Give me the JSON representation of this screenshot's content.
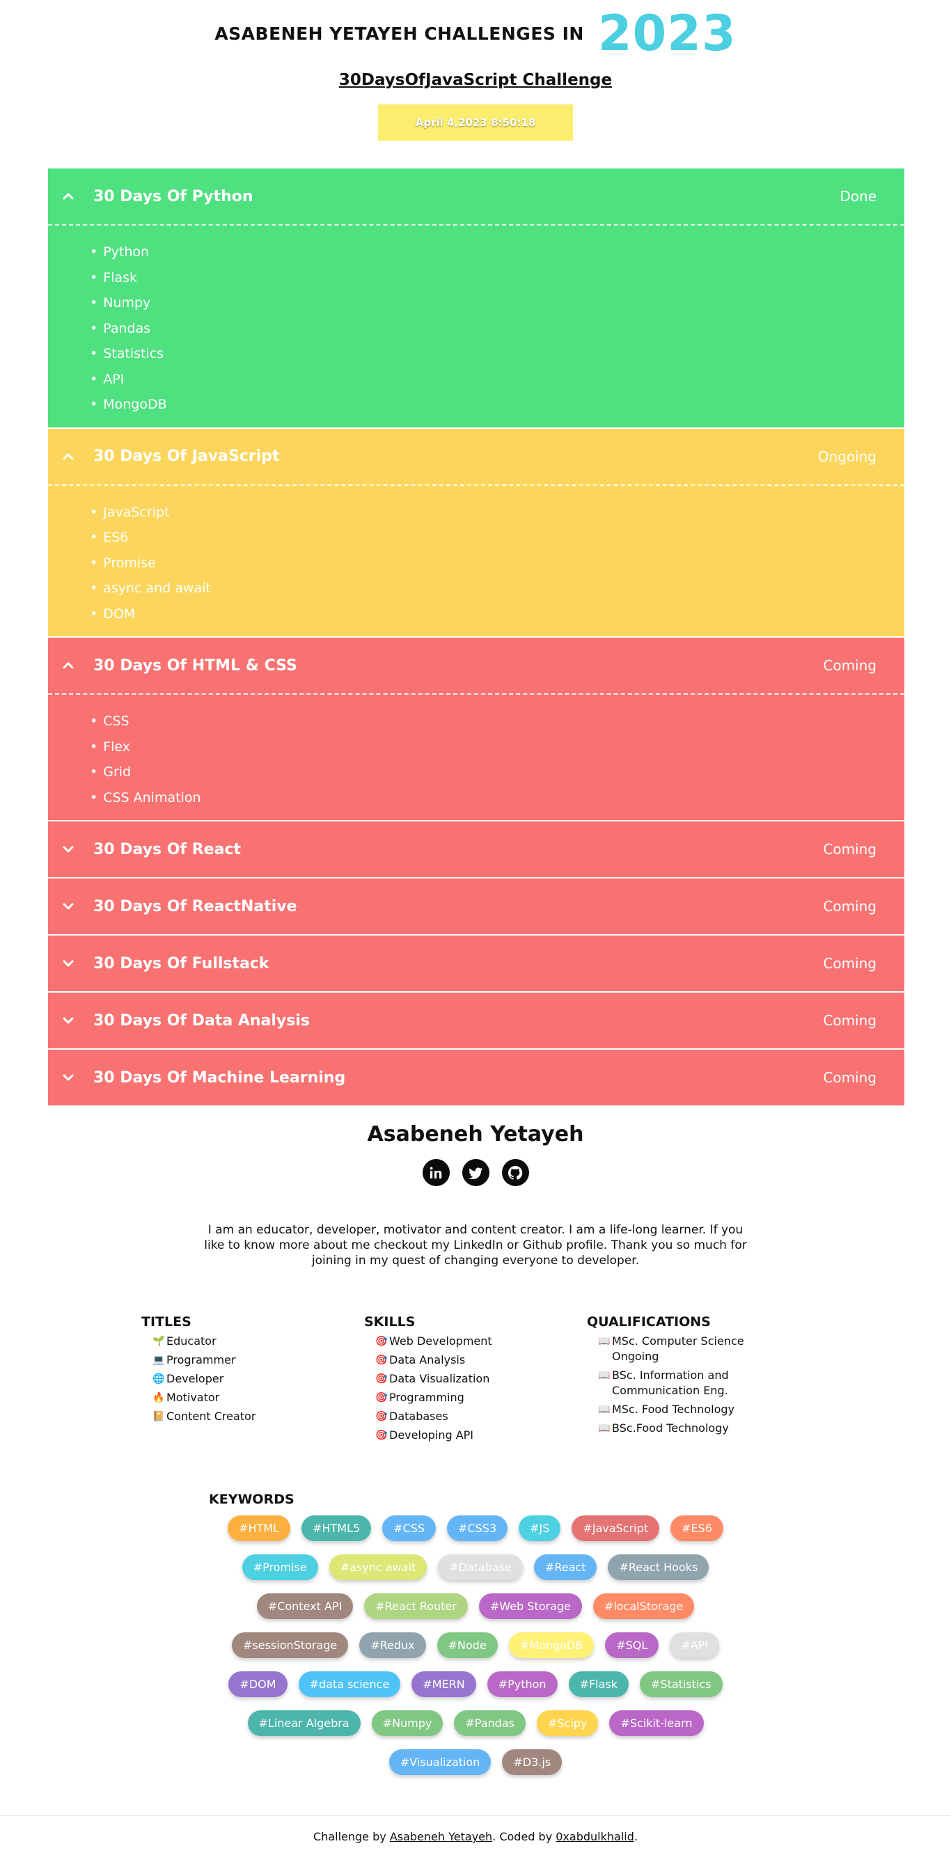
{
  "header": {
    "title": "ASABENEH YETAYEH CHALLENGES IN",
    "year": "2023",
    "subtitle": "30DaysOfJavaScript Challenge",
    "datetime": "April 4,2023 8:50:18"
  },
  "challenges": [
    {
      "title": "30 Days Of Python",
      "status": "Done",
      "color": "#4fe07f",
      "expanded": true,
      "toggle_icon": "chevron-up-icon",
      "topics": [
        "Python",
        "Flask",
        "Numpy",
        "Pandas",
        "Statistics",
        "API",
        "MongoDB"
      ]
    },
    {
      "title": "30 Days Of JavaScript",
      "status": "Ongoing",
      "color": "#fcd65c",
      "expanded": true,
      "toggle_icon": "chevron-up-icon",
      "topics": [
        "JavaScript",
        "ES6",
        "Promise",
        "async and await",
        "DOM"
      ]
    },
    {
      "title": "30 Days Of HTML & CSS",
      "status": "Coming",
      "color": "#f87272",
      "expanded": true,
      "toggle_icon": "chevron-up-icon",
      "topics": [
        "CSS",
        "Flex",
        "Grid",
        "CSS Animation"
      ]
    },
    {
      "title": "30 Days Of React",
      "status": "Coming",
      "color": "#f87272",
      "expanded": false,
      "toggle_icon": "chevron-down-icon",
      "topics": []
    },
    {
      "title": "30 Days Of ReactNative",
      "status": "Coming",
      "color": "#f87272",
      "expanded": false,
      "toggle_icon": "chevron-down-icon",
      "topics": []
    },
    {
      "title": "30 Days Of Fullstack",
      "status": "Coming",
      "color": "#f87272",
      "expanded": false,
      "toggle_icon": "chevron-down-icon",
      "topics": []
    },
    {
      "title": "30 Days Of Data Analysis",
      "status": "Coming",
      "color": "#f87272",
      "expanded": false,
      "toggle_icon": "chevron-down-icon",
      "topics": []
    },
    {
      "title": "30 Days Of Machine Learning",
      "status": "Coming",
      "color": "#f87272",
      "expanded": false,
      "toggle_icon": "chevron-down-icon",
      "topics": []
    }
  ],
  "author": {
    "name": "Asabeneh Yetayeh",
    "socials": [
      "linkedin-icon",
      "twitter-icon",
      "github-icon"
    ],
    "bio": "I am an educator, developer, motivator and content creator. I am a life-long learner. If you like to know more about me checkout my LinkedIn or Github profile. Thank you so much for joining in my quest of changing everyone to developer."
  },
  "titles": {
    "heading": "TITLES",
    "items": [
      {
        "icon": "🌱",
        "label": "Educator"
      },
      {
        "icon": "💻",
        "label": "Programmer"
      },
      {
        "icon": "🌐",
        "label": "Developer"
      },
      {
        "icon": "🔥",
        "label": "Motivator"
      },
      {
        "icon": "📔",
        "label": "Content Creator"
      }
    ]
  },
  "skills": {
    "heading": "SKILLS",
    "icon": "🎯",
    "items": [
      "Web Development",
      "Data Analysis",
      "Data Visualization",
      "Programming",
      "Databases",
      "Developing API"
    ]
  },
  "qualifications": {
    "heading": "QUALIFICATIONS",
    "icon": "📖",
    "items": [
      "MSc. Computer Science Ongoing",
      "BSc. Information and Communication Eng.",
      "MSc. Food Technology",
      "BSc.Food Technology"
    ]
  },
  "keywords": {
    "heading": "KEYWORDS",
    "items": [
      {
        "label": "#HTML",
        "color": "#fbb040"
      },
      {
        "label": "#HTML5",
        "color": "#4db6ac"
      },
      {
        "label": "#CSS",
        "color": "#64b5f6"
      },
      {
        "label": "#CSS3",
        "color": "#64b5f6"
      },
      {
        "label": "#JS",
        "color": "#4dd0e1"
      },
      {
        "label": "#JavaScript",
        "color": "#e57373"
      },
      {
        "label": "#ES6",
        "color": "#ff8a65"
      },
      {
        "label": "#Promise",
        "color": "#4dd0e1"
      },
      {
        "label": "#async await",
        "color": "#dce775"
      },
      {
        "label": "#Database",
        "color": "#e0e0e0"
      },
      {
        "label": "#React",
        "color": "#64b5f6"
      },
      {
        "label": "#React Hooks",
        "color": "#90a4ae"
      },
      {
        "label": "#Context API",
        "color": "#a1887f"
      },
      {
        "label": "#React Router",
        "color": "#aed581"
      },
      {
        "label": "#Web Storage",
        "color": "#ba68c8"
      },
      {
        "label": "#localStorage",
        "color": "#ff8a65"
      },
      {
        "label": "#sessionStorage",
        "color": "#a1887f"
      },
      {
        "label": "#Redux",
        "color": "#90a4ae"
      },
      {
        "label": "#Node",
        "color": "#81c784"
      },
      {
        "label": "#MongoDB",
        "color": "#fff176"
      },
      {
        "label": "#SQL",
        "color": "#ba68c8"
      },
      {
        "label": "#API",
        "color": "#e0e0e0"
      },
      {
        "label": "#DOM",
        "color": "#9575cd"
      },
      {
        "label": "#data science",
        "color": "#4fc3f7"
      },
      {
        "label": "#MERN",
        "color": "#9575cd"
      },
      {
        "label": "#Python",
        "color": "#ba68c8"
      },
      {
        "label": "#Flask",
        "color": "#4db6ac"
      },
      {
        "label": "#Statistics",
        "color": "#81c784"
      },
      {
        "label": "#Linear Algebra",
        "color": "#4db6ac"
      },
      {
        "label": "#Numpy",
        "color": "#81c784"
      },
      {
        "label": "#Pandas",
        "color": "#81c784"
      },
      {
        "label": "#Scipy",
        "color": "#ffd54f"
      },
      {
        "label": "#Scikit-learn",
        "color": "#ba68c8"
      },
      {
        "label": "#Visualization",
        "color": "#64b5f6"
      },
      {
        "label": "#D3.js",
        "color": "#a1887f"
      }
    ]
  },
  "footer": {
    "prefix": "Challenge by ",
    "author_link": "Asabeneh Yetayeh",
    "middle": ". Coded by ",
    "coder_link": "0xabdulkhalid",
    "suffix": "."
  }
}
